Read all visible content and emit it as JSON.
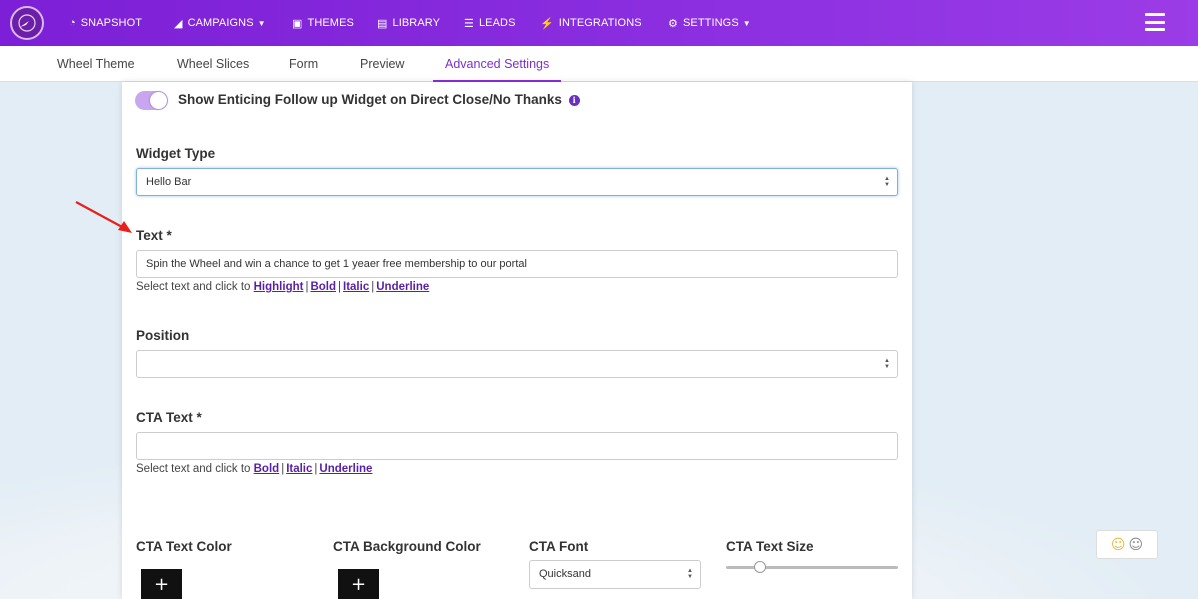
{
  "nav": {
    "items": [
      {
        "label": "SNAPSHOT",
        "icon": "dashboard-icon"
      },
      {
        "label": "CAMPAIGNS",
        "icon": "paper-plane-icon",
        "caret": true
      },
      {
        "label": "THEMES",
        "icon": "image-icon"
      },
      {
        "label": "LIBRARY",
        "icon": "library-icon"
      },
      {
        "label": "LEADS",
        "icon": "list-icon"
      },
      {
        "label": "INTEGRATIONS",
        "icon": "plug-icon"
      },
      {
        "label": "SETTINGS",
        "icon": "gears-icon",
        "caret": true
      }
    ],
    "menu_icon": "hamburger-menu-icon"
  },
  "tabs": [
    {
      "label": "Wheel Theme"
    },
    {
      "label": "Wheel Slices"
    },
    {
      "label": "Form"
    },
    {
      "label": "Preview"
    },
    {
      "label": "Advanced Settings",
      "active": true
    }
  ],
  "form": {
    "follow_up_toggle": {
      "label": "Show Enticing Follow up Widget on Direct Close/No Thanks",
      "on": true
    },
    "widget_type": {
      "label": "Widget Type",
      "value": "Hello Bar"
    },
    "text": {
      "label": "Text *",
      "value": "Spin the Wheel and win a chance to get 1 yeaer free membership to our portal",
      "hint_prefix": "Select text and click to",
      "links": [
        "Highlight",
        "Bold",
        "Italic",
        "Underline"
      ]
    },
    "position": {
      "label": "Position",
      "value": ""
    },
    "cta_text": {
      "label": "CTA Text *",
      "value": "",
      "hint_prefix": "Select text and click to",
      "links": [
        "Bold",
        "Italic",
        "Underline"
      ]
    },
    "cta_text_color": {
      "label": "CTA Text Color",
      "button": "+"
    },
    "cta_background_color": {
      "label": "CTA Background Color",
      "button": "+"
    },
    "cta_font": {
      "label": "CTA Font",
      "value": "Quicksand"
    },
    "cta_text_size": {
      "label": "CTA Text Size",
      "value_fraction": 0.2
    }
  },
  "colors": {
    "brand": "#8a2ee0",
    "active_tab": "#7b2fd0",
    "link": "#5a1fa8",
    "annotation_arrow": "#e8201c"
  }
}
